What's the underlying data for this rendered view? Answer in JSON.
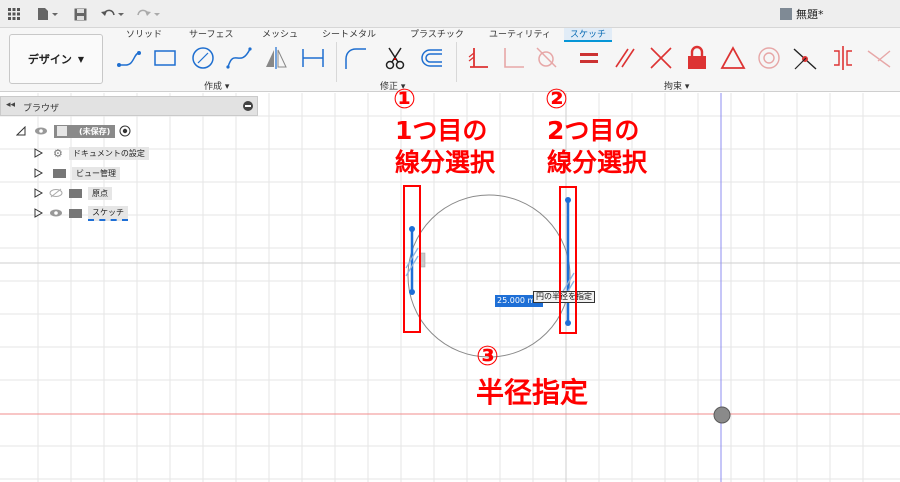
{
  "document": {
    "title": "無題*"
  },
  "workspace": {
    "label": "デザイン"
  },
  "ribbon": {
    "tabs": [
      {
        "label": "ソリッド",
        "active": false
      },
      {
        "label": "サーフェス",
        "active": false
      },
      {
        "label": "メッシュ",
        "active": false
      },
      {
        "label": "シートメタル",
        "active": false
      },
      {
        "label": "プラスチック",
        "active": false
      },
      {
        "label": "ユーティリティ",
        "active": false
      },
      {
        "label": "スケッチ",
        "active": true
      }
    ],
    "groups": {
      "create": "作成",
      "modify": "修正",
      "constraint": "拘束"
    }
  },
  "browser": {
    "title": "ブラウザ",
    "root": "(未保存)",
    "items": [
      {
        "label": "ドキュメントの設定",
        "icon": "gear-icon"
      },
      {
        "label": "ビュー管理",
        "icon": "folder-icon"
      },
      {
        "label": "原点",
        "icon": "folder-icon"
      },
      {
        "label": "スケッチ",
        "icon": "folder-icon"
      }
    ]
  },
  "sketch": {
    "radius_value": "25.000 m",
    "radius_tooltip": "円の半径を指定"
  },
  "annotations": {
    "step1": {
      "marker": "①",
      "line1": "1つ目の",
      "line2": "線分選択"
    },
    "step2": {
      "marker": "②",
      "line1": "2つ目の",
      "line2": "線分選択"
    },
    "step3": {
      "marker": "③",
      "line1": "半径指定"
    }
  },
  "colors": {
    "annotation": "#ff0000",
    "selection": "#1e6fd6",
    "active_tab": "#0696d7"
  }
}
